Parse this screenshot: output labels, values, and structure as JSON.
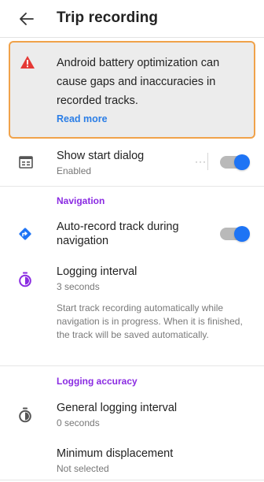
{
  "header": {
    "title": "Trip recording",
    "back_icon": "arrow-back-icon"
  },
  "warning": {
    "icon": "warning-triangle-icon",
    "text": "Android battery optimization can cause gaps and inaccuracies in recorded tracks.",
    "link_label": "Read more",
    "border_color": "#f0a24a",
    "link_color": "#2b7ee6",
    "icon_color": "#e53935"
  },
  "show_start_dialog": {
    "icon": "dialog-icon",
    "title": "Show start dialog",
    "status": "Enabled",
    "more_icon": "more-dots-icon",
    "enabled": true
  },
  "navigation_section": {
    "header": "Navigation",
    "auto_record": {
      "icon": "navigation-arrow-icon",
      "title": "Auto-record track during navigation",
      "enabled": true
    },
    "logging_interval": {
      "icon": "timer-icon",
      "title": "Logging interval",
      "value": "3 seconds",
      "description": "Start track recording automatically while navigation is in progress. When it is finished, the track will be saved automatically."
    }
  },
  "accuracy_section": {
    "header": "Logging accuracy",
    "general_interval": {
      "icon": "timer-icon",
      "title": "General logging interval",
      "value": "0 seconds"
    },
    "min_displacement": {
      "title": "Minimum displacement",
      "value": "Not selected"
    }
  },
  "colors": {
    "accent": "#1e74f5",
    "section_header": "#8a2be2",
    "timer_nav": "#8a2be2"
  }
}
